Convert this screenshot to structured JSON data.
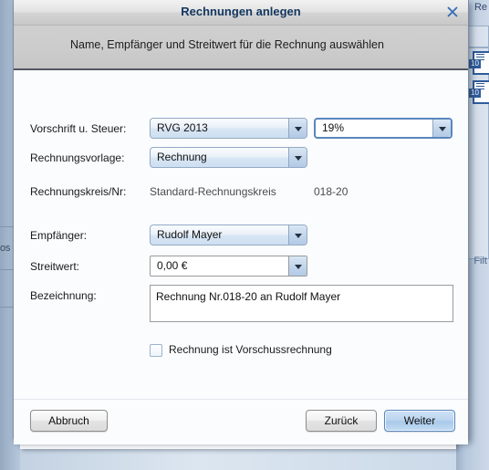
{
  "background": {
    "right_panel_title": "Re",
    "filter_label": "Filt",
    "doc_badge": "10",
    "left_label": "os"
  },
  "dialog": {
    "title": "Rechnungen anlegen",
    "close_icon": "close-icon",
    "subtitle": "Name, Empfänger und Streitwert für die Rechnung auswählen",
    "fields": {
      "vorschrift": {
        "label": "Vorschrift u. Steuer:",
        "value": "RVG 2013"
      },
      "steuer": {
        "value": "19%"
      },
      "vorlage": {
        "label": "Rechnungsvorlage:",
        "value": "Rechnung"
      },
      "rechnungskreis": {
        "label": "Rechnungskreis/Nr:",
        "value": "Standard-Rechnungskreis",
        "number": "018-20"
      },
      "empfaenger": {
        "label": "Empfänger:",
        "value": "Rudolf Mayer"
      },
      "streitwert": {
        "label": "Streitwert:",
        "value": "0,00 €"
      },
      "bezeichnung": {
        "label": "Bezeichnung:",
        "value": "Rechnung Nr.018-20 an Rudolf Mayer"
      },
      "vorschuss": {
        "label": "Rechnung ist Vorschussrechnung",
        "checked": false
      }
    },
    "buttons": {
      "cancel": "Abbruch",
      "back": "Zurück",
      "next": "Weiter"
    }
  },
  "colors": {
    "title_text": "#12365f",
    "accent_blue": "#5a87bc",
    "combo_border": "#93aac4",
    "dialog_bg": "#fbfcfe",
    "subtitle_band": "#cccccc"
  }
}
